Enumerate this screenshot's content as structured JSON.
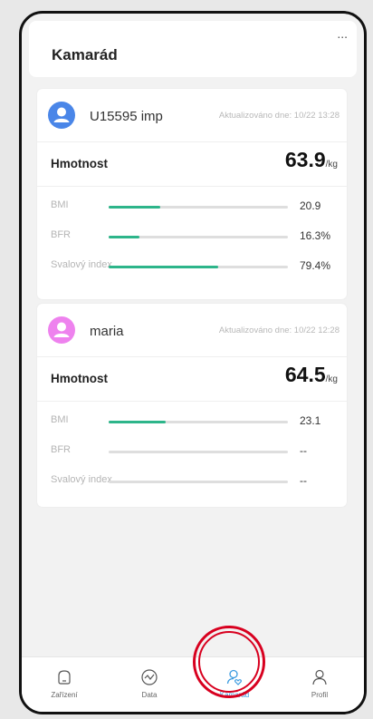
{
  "header": {
    "title": "Kamarád",
    "more_label": "..."
  },
  "friends": [
    {
      "name": "U15595 imp",
      "updated": "Aktualizováno dne: 10/22 13:28",
      "avatar_color": "#4a86e8",
      "weight_label": "Hmotnost",
      "weight_value": "63.9",
      "weight_unit": "/kg",
      "metrics": [
        {
          "label": "BMI",
          "value": "20.9",
          "level": 0.29
        },
        {
          "label": "BFR",
          "value": "16.3%",
          "level": 0.17
        },
        {
          "label": "Svalový index",
          "value": "79.4%",
          "level": 0.61
        }
      ]
    },
    {
      "name": "maria",
      "updated": "Aktualizováno dne: 10/22 12:28",
      "avatar_color": "#ee82ee",
      "weight_label": "Hmotnost",
      "weight_value": "64.5",
      "weight_unit": "/kg",
      "metrics": [
        {
          "label": "BMI",
          "value": "23.1",
          "level": 0.32
        },
        {
          "label": "BFR",
          "value": "--",
          "level": 0
        },
        {
          "label": "Svalový index",
          "value": "--",
          "level": 0
        }
      ]
    }
  ],
  "nav": [
    {
      "label": "Zařízení",
      "icon": "device-icon",
      "active": false
    },
    {
      "label": "Data",
      "icon": "chart-icon",
      "active": false
    },
    {
      "label": "Kamarád",
      "icon": "friend-icon",
      "active": true
    },
    {
      "label": "Profil",
      "icon": "profile-icon",
      "active": false
    }
  ],
  "colors": {
    "accent": "#3b9be0",
    "bar_fill": "#2db58a",
    "highlight": "#d8001f"
  }
}
